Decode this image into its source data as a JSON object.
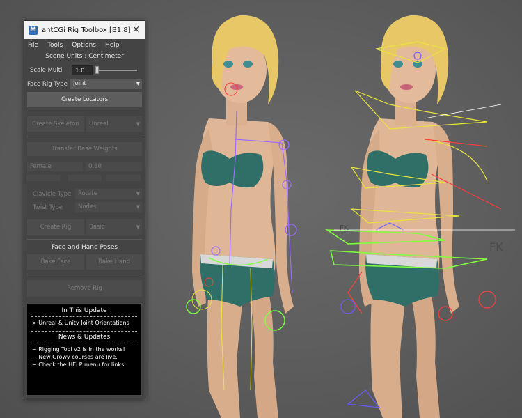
{
  "window": {
    "app_icon": "M",
    "title": "antCGi Rig Toolbox [B1.8]",
    "close_glyph": "×"
  },
  "menu": [
    "File",
    "Tools",
    "Options",
    "Help"
  ],
  "scene_units": "Scene Units :  Centimeter",
  "scale_multi": {
    "label": "Scale Multi",
    "value": "1.0"
  },
  "face_rig_type": {
    "label": "Face Rig Type",
    "value": "Joint"
  },
  "buttons": {
    "create_locators": "Create Locators",
    "create_skeleton": "Create Skeleton",
    "transfer_base_weights": "Transfer Base Weights",
    "create_rig": "Create Rig",
    "bake_face": "Bake Face",
    "bake_hand": "Bake Hand",
    "remove_rig": "Remove Rig"
  },
  "skeleton_target": "Unreal",
  "weights": {
    "gender": "Female",
    "value": "0.80"
  },
  "clavicle_type": {
    "label": "Clavicle Type",
    "value": "Rotate"
  },
  "twist_type": {
    "label": "Twist Type",
    "value": "Nodes"
  },
  "rig_style": "Basic",
  "face_hand_poses": "Face and Hand Poses",
  "info": {
    "update_title": "In This Update",
    "update_line": ">  Unreal & Unity Joint Orientations",
    "news_title": "News & Updates",
    "news": [
      "~  Rigging Tool v2 is in the works!",
      "~  New Growy courses are live.",
      "~  Check the HELP menu for links."
    ]
  },
  "viewport_labels": {
    "fk_left": "FK",
    "fk_right": "FK"
  },
  "colors": {
    "panel_bg": "#444444",
    "viewport_bg": "#5d5d5d",
    "skin": "#e0b796",
    "hair": "#e8c866",
    "swimwear": "#2f6f68",
    "rig_green": "#7dff3d",
    "rig_yellow": "#e9e33c",
    "rig_purple": "#9a6cff",
    "rig_red": "#ff3b3b"
  }
}
